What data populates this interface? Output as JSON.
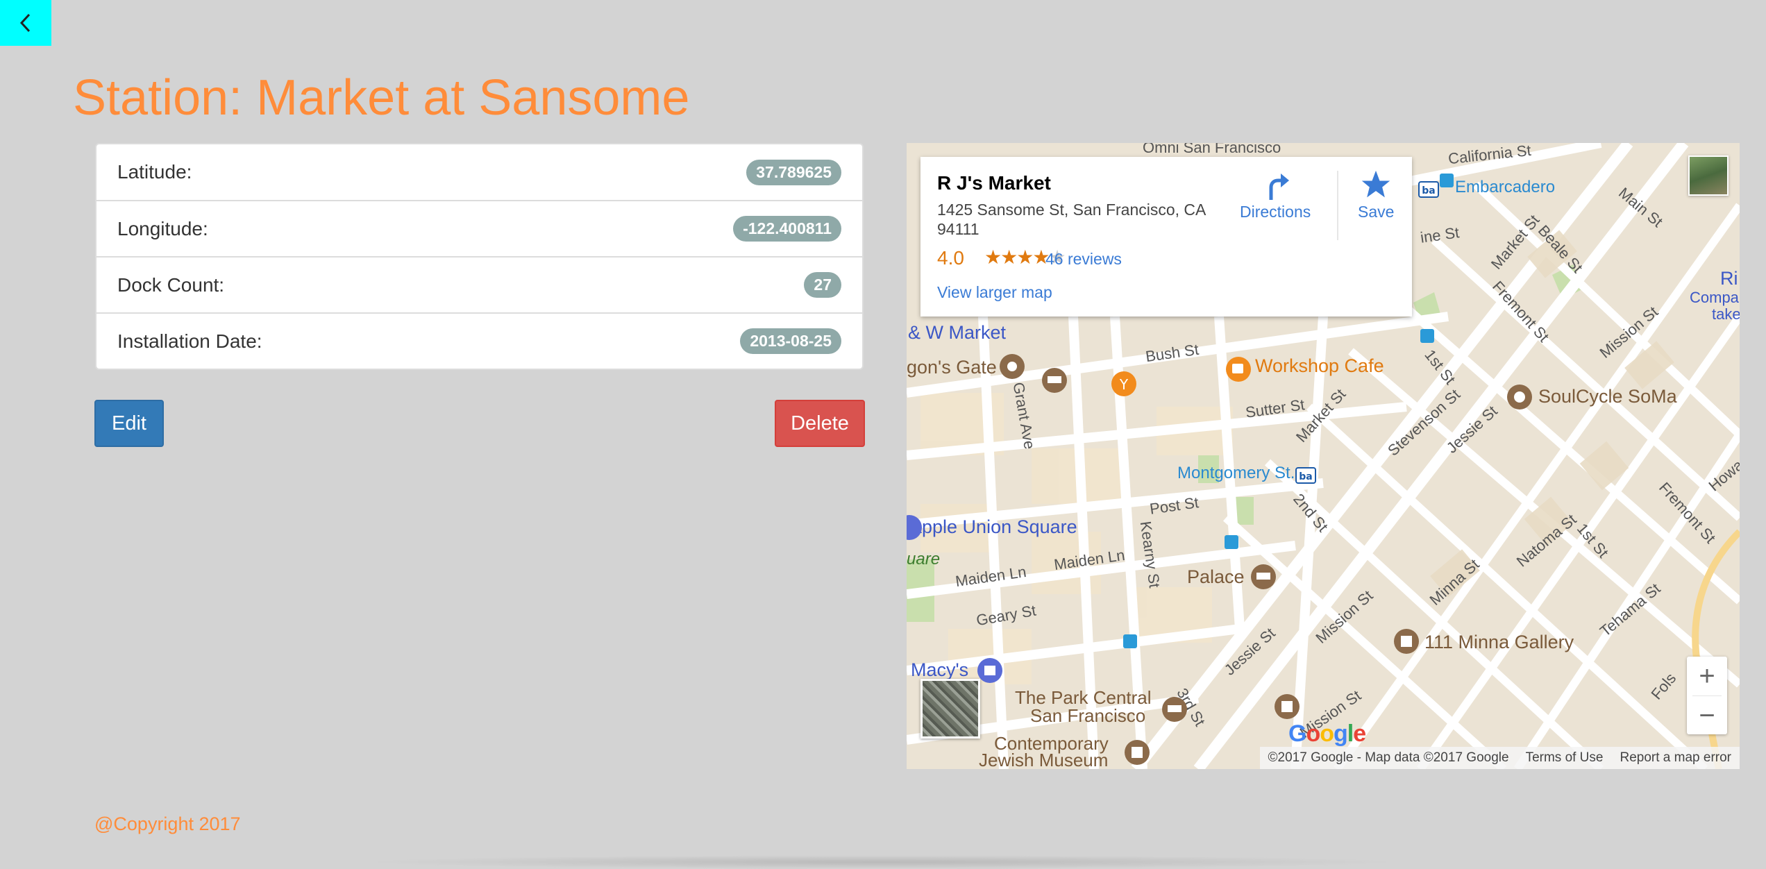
{
  "title": "Station: Market at Sansome",
  "details": [
    {
      "label": "Latitude:",
      "value": "37.789625"
    },
    {
      "label": "Longitude:",
      "value": "-122.400811"
    },
    {
      "label": "Dock Count:",
      "value": "27"
    },
    {
      "label": "Installation Date:",
      "value": "2013-08-25"
    }
  ],
  "actions": {
    "edit": "Edit",
    "delete": "Delete"
  },
  "map": {
    "place": {
      "name": "R J's Market",
      "address": "1425 Sansome St, San Francisco, CA 94111",
      "rating": "4.0",
      "stars": 4,
      "reviews": "46 reviews",
      "view_larger": "View larger map",
      "directions": "Directions",
      "save": "Save"
    },
    "labels": {
      "omni": "Omni San Francisco",
      "california": "California St",
      "embarcadero": "Embarcadero",
      "pine": "ine St",
      "main": "Main St",
      "beale": "Beale St",
      "market_st1": "Market St",
      "fremont1": "Fremont St",
      "mission1": "Mission St",
      "ri": "Ri",
      "compa": "Compa",
      "take": "take",
      "w_market": "& W Market",
      "gons_gate": "gon's Gate",
      "grant": "Grant Ave",
      "bush": "Bush St",
      "workshop": "Workshop Cafe",
      "first_st1": "1st St",
      "soulcycle": "SoulCycle SoMa",
      "sutter": "Sutter St",
      "market_st2": "Market St",
      "stevenson": "Stevenson St",
      "jessie1": "Jessie St",
      "montgomery": "Montgomery St.",
      "second": "2nd St",
      "howard": "Howard",
      "fremont2": "Fremont St",
      "post": "Post St",
      "kearny": "Kearny St",
      "apple": "Apple Union Square",
      "uare": "uare",
      "maiden1": "Maiden Ln",
      "maiden2": "Maiden Ln",
      "palace": "Palace",
      "natoma": "Natoma St",
      "minna": "Minna St",
      "first_st2": "1st St",
      "geary": "Geary St",
      "mission2": "Mission St",
      "jessie2": "Jessie St",
      "minna_gallery": "111 Minna Gallery",
      "tehama": "Tehama St",
      "macys": "Macy's",
      "park_central1": "The Park Central",
      "park_central2": "San Francisco",
      "third": "3rd St",
      "mission3": "Mission St",
      "folsom": "Fols",
      "cjm1": "Contemporary",
      "cjm2": "Jewish Museum"
    },
    "google_logo": "Google",
    "attribution": "©2017 Google - Map data ©2017 Google",
    "terms": "Terms of Use",
    "report": "Report a map error",
    "zoom_in": "+",
    "zoom_out": "−"
  },
  "footer": "@Copyright 2017"
}
